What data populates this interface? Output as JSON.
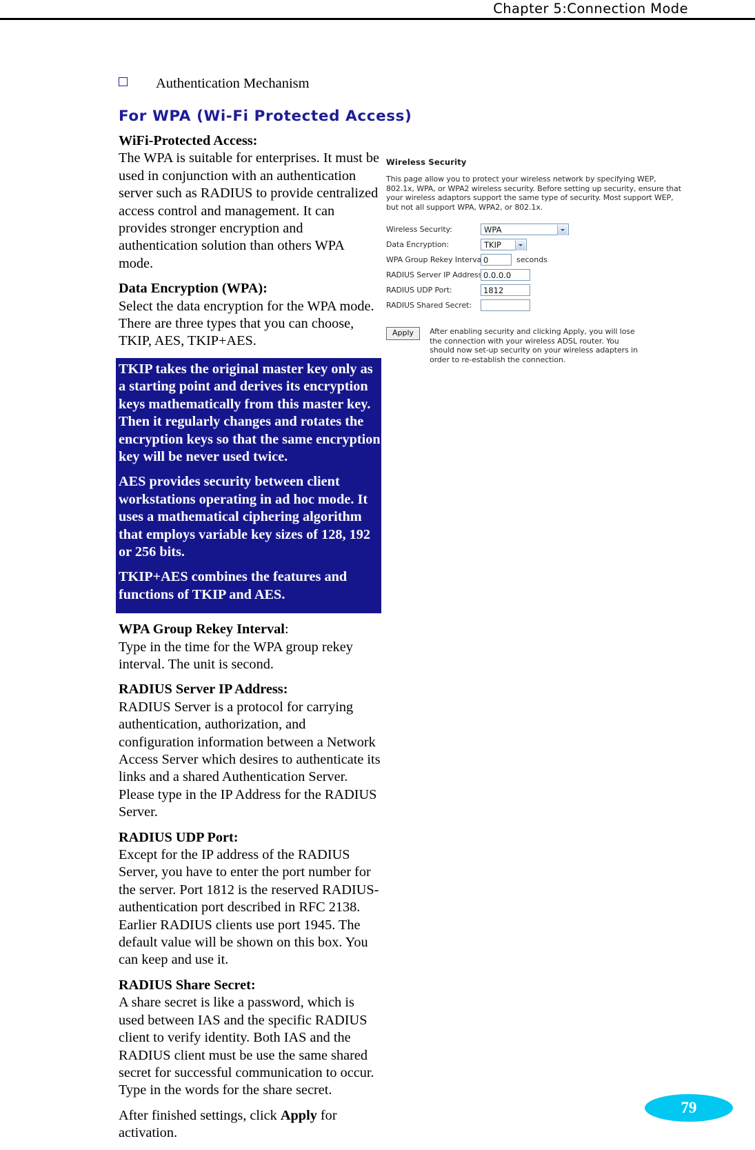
{
  "header": {
    "chapter_title": "Chapter 5:Connection Mode"
  },
  "bullet": {
    "label": "Authentication Mechanism"
  },
  "section": {
    "heading": "For WPA (Wi-Fi Protected Access)"
  },
  "body": {
    "wifi_protected_access_label": "WiFi-Protected Access:",
    "wifi_protected_access_text": "The WPA is suitable for enterprises. It must be used in conjunction with an authentication server such as RADIUS to provide centralized access control and management. It can provides stronger encryption and authentication solution than others WPA mode.",
    "data_encryption_label": "Data Encryption (WPA):",
    "data_encryption_text": "Select the data encryption for the WPA mode. There are three types that you can choose, TKIP, AES, TKIP+AES.",
    "callout": {
      "tkip": "TKIP takes the original master key only as a starting point and derives its encryption keys mathematically from this master key. Then it regularly changes and rotates the encryption keys so that the same encryption key will be never used twice.",
      "aes": "AES provides security between client workstations operating in ad hoc mode. It uses a mathematical ciphering algorithm that employs variable key sizes of 128, 192 or 256 bits.",
      "tkip_aes": "TKIP+AES combines the features and functions of TKIP and AES."
    },
    "group_rekey_label": "WPA Group Rekey Interval",
    "group_rekey_colon": ":",
    "group_rekey_text": "Type in the time for the WPA group rekey interval. The unit is second.",
    "radius_ip_label": "RADIUS Server IP Address:",
    "radius_ip_text": "RADIUS Server is a protocol for carrying authentication, authorization, and configuration information between a Network Access Server which desires to authenticate its links and a shared Authentication Server. Please type in the IP Address for the RADIUS Server.",
    "radius_port_label": "RADIUS UDP Port:",
    "radius_port_text": "Except for the IP address of the RADIUS Server, you have to enter the port number for the server. Port 1812 is the reserved RADIUS-authentication port described in RFC 2138. Earlier RADIUS clients use port 1945. The default value will be shown on this box. You can keep and use it.",
    "radius_secret_label": "RADIUS Share Secret:",
    "radius_secret_text": "A share secret is like a password, which is used between IAS and the specific RADIUS client to verify identity. Both IAS and the RADIUS client must be use the same shared secret for successful communication to occur. Type in the words for the share secret.",
    "closing_pre": "After finished settings, click ",
    "closing_bold": "Apply",
    "closing_post": " for activation."
  },
  "router_panel": {
    "title": "Wireless Security",
    "description": "This page allow you to protect your wireless network by specifying WEP, 802.1x, WPA, or WPA2 wireless security. Before setting up security, ensure that your wireless adaptors support the same type of security. Most support WEP, but not all support WPA, WPA2, or 802.1x.",
    "fields": [
      {
        "label": "Wireless Security:",
        "value": "WPA",
        "control": "select"
      },
      {
        "label": "Data Encryption:",
        "value": "TKIP",
        "control": "select"
      },
      {
        "label": "WPA Group Rekey Interval:",
        "value": "0",
        "control": "text",
        "unit": "seconds"
      },
      {
        "label": "RADIUS Server IP Address:",
        "value": "0.0.0.0",
        "control": "text"
      },
      {
        "label": "RADIUS UDP Port:",
        "value": "1812",
        "control": "text"
      },
      {
        "label": "RADIUS Shared Secret:",
        "value": "",
        "control": "text"
      }
    ],
    "apply_button": "Apply",
    "apply_note": "After enabling security and clicking Apply, you will lose the connection with your wireless ADSL router. You should now set-up security on your wireless adapters in order to re-establish the connection."
  },
  "footer": {
    "page_number": "79"
  },
  "colors": {
    "heading_blue": "#1d1d96",
    "callout_bg": "#16168c",
    "callout_text": "#ffffff",
    "page_badge": "#00c8f0",
    "field_border": "#7a9ab5"
  }
}
